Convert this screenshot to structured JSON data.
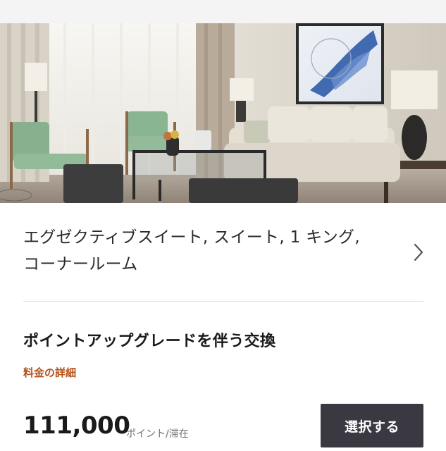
{
  "room": {
    "title_line1": "エグゼクティブスイート, スイート, 1 キング,",
    "title_line2": "コーナールーム"
  },
  "rate": {
    "title": "ポイントアップグレードを伴う交換",
    "details_link": "料金の詳細"
  },
  "price": {
    "amount": "111,000",
    "unit": "ポイント/滞在"
  },
  "actions": {
    "select_label": "選択する"
  },
  "icons": {
    "chevron": "chevron-right-icon"
  },
  "colors": {
    "link": "#b5521b",
    "button_bg": "#3a3840",
    "button_text": "#ffffff"
  }
}
